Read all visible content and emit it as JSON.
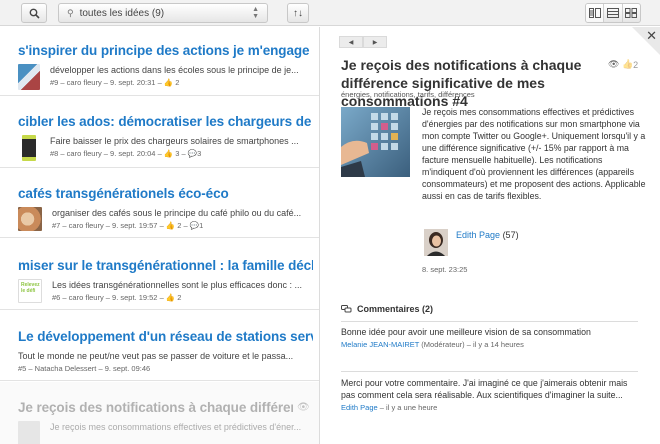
{
  "toolbar": {
    "search_icon": "search-icon",
    "filter_value": "toutes les idées (9)",
    "sort_icon": "sort-icon",
    "view_modes": [
      "list-detail-icon",
      "list-icon",
      "grid-icon"
    ]
  },
  "list": [
    {
      "title": "s'inspirer du principe des actions je m'engage à ...",
      "desc": "développer les actions dans les écoles sous le principe de je...",
      "meta": "#9 – caro fleury – 9. sept. 20:31 – ",
      "likes": "2",
      "comments": "",
      "thumb_colors": [
        "#4a90c2",
        "#e0e8f0"
      ]
    },
    {
      "title": "cibler les ados: démocratiser les chargeurs de s...",
      "desc": "Faire baisser le prix des chargeurs solaires de smartphones ...",
      "meta": "#8 – caro fleury – 9. sept. 20:04 – ",
      "likes": "3",
      "comments": "3",
      "thumb_colors": [
        "#2a2a2a",
        "#c6d94a"
      ]
    },
    {
      "title": "cafés transgénérationels éco-éco",
      "desc": "organiser des cafés sous le principe du café philo ou du café...",
      "meta": "#7 – caro fleury – 9. sept. 19:57 – ",
      "likes": "2",
      "comments": "1",
      "thumb_colors": [
        "#c98a5a",
        "#e9c9a6"
      ]
    },
    {
      "title": "miser sur le transgénérationnel : la famille déclics",
      "desc": "Les idées transgénérationnelles sont le plus efficaces donc : ...",
      "meta": "#6 – caro fleury – 9. sept. 19:52 – ",
      "likes": "2",
      "comments": "",
      "thumb_colors": [
        "#ffffff",
        "#8cc43f"
      ],
      "thumb_text": "Relevez le défi"
    },
    {
      "title": "Le développement d'un réseau de stations servi...",
      "desc": "Tout le monde ne peut/ne veut pas se passer de voiture et le passa...",
      "meta": "#5 – Natacha Delessert – 9. sept. 09:46",
      "likes": "",
      "comments": ""
    },
    {
      "title": "Je reçois des notifications à chaque différence...",
      "desc": "Je reçois mes consommations effectives et prédictives d'éner...",
      "meta": "",
      "likes": "",
      "comments": ""
    }
  ],
  "detail": {
    "title": "Je reçois des notifications à chaque différence significative de mes consommations #4",
    "views_icon": "eye-icon",
    "likes": "2",
    "tags": "énergies, notifications, tarifs, différences",
    "text": "Je reçois mes consommations effectives et prédictives d'énergies par des notifications sur mon smartphone via mon compte Twitter ou Google+. Uniquement lorsqu'il y a une différence significative (+/- 15% par rapport à ma facture mensuelle habituelle). Les notifications m'indiquent d'où proviennent les différences (appareils consommateurs) et me proposent des actions. Applicable aussi en cas de tarifs flexibles.",
    "author": "Edith Page",
    "author_count": "(57)",
    "date": "8. sept. 23:25",
    "comments_title": "Commentaires (2)",
    "comments": [
      {
        "text": "Bonne idée pour avoir une meilleure vision de sa consommation",
        "author": "Melanie JEAN-MAIRET",
        "role_time": " (Modérateur) – il y a 14 heures"
      },
      {
        "text": "Merci pour votre commentaire. J'ai imaginé ce que j'aimerais obtenir mais pas comment cela sera réalisable. Aux scientifiques d'imaginer la suite...",
        "author": "Edith Page",
        "role_time": " – il y a une heure"
      }
    ]
  }
}
